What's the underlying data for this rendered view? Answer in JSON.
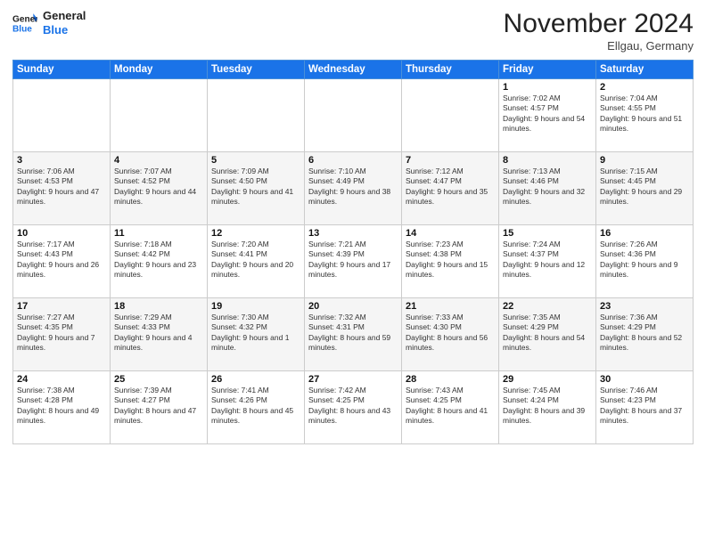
{
  "header": {
    "logo_line1": "General",
    "logo_line2": "Blue",
    "month_title": "November 2024",
    "location": "Ellgau, Germany"
  },
  "columns": [
    "Sunday",
    "Monday",
    "Tuesday",
    "Wednesday",
    "Thursday",
    "Friday",
    "Saturday"
  ],
  "weeks": [
    [
      {
        "day": "",
        "info": ""
      },
      {
        "day": "",
        "info": ""
      },
      {
        "day": "",
        "info": ""
      },
      {
        "day": "",
        "info": ""
      },
      {
        "day": "",
        "info": ""
      },
      {
        "day": "1",
        "info": "Sunrise: 7:02 AM\nSunset: 4:57 PM\nDaylight: 9 hours and 54 minutes."
      },
      {
        "day": "2",
        "info": "Sunrise: 7:04 AM\nSunset: 4:55 PM\nDaylight: 9 hours and 51 minutes."
      }
    ],
    [
      {
        "day": "3",
        "info": "Sunrise: 7:06 AM\nSunset: 4:53 PM\nDaylight: 9 hours and 47 minutes."
      },
      {
        "day": "4",
        "info": "Sunrise: 7:07 AM\nSunset: 4:52 PM\nDaylight: 9 hours and 44 minutes."
      },
      {
        "day": "5",
        "info": "Sunrise: 7:09 AM\nSunset: 4:50 PM\nDaylight: 9 hours and 41 minutes."
      },
      {
        "day": "6",
        "info": "Sunrise: 7:10 AM\nSunset: 4:49 PM\nDaylight: 9 hours and 38 minutes."
      },
      {
        "day": "7",
        "info": "Sunrise: 7:12 AM\nSunset: 4:47 PM\nDaylight: 9 hours and 35 minutes."
      },
      {
        "day": "8",
        "info": "Sunrise: 7:13 AM\nSunset: 4:46 PM\nDaylight: 9 hours and 32 minutes."
      },
      {
        "day": "9",
        "info": "Sunrise: 7:15 AM\nSunset: 4:45 PM\nDaylight: 9 hours and 29 minutes."
      }
    ],
    [
      {
        "day": "10",
        "info": "Sunrise: 7:17 AM\nSunset: 4:43 PM\nDaylight: 9 hours and 26 minutes."
      },
      {
        "day": "11",
        "info": "Sunrise: 7:18 AM\nSunset: 4:42 PM\nDaylight: 9 hours and 23 minutes."
      },
      {
        "day": "12",
        "info": "Sunrise: 7:20 AM\nSunset: 4:41 PM\nDaylight: 9 hours and 20 minutes."
      },
      {
        "day": "13",
        "info": "Sunrise: 7:21 AM\nSunset: 4:39 PM\nDaylight: 9 hours and 17 minutes."
      },
      {
        "day": "14",
        "info": "Sunrise: 7:23 AM\nSunset: 4:38 PM\nDaylight: 9 hours and 15 minutes."
      },
      {
        "day": "15",
        "info": "Sunrise: 7:24 AM\nSunset: 4:37 PM\nDaylight: 9 hours and 12 minutes."
      },
      {
        "day": "16",
        "info": "Sunrise: 7:26 AM\nSunset: 4:36 PM\nDaylight: 9 hours and 9 minutes."
      }
    ],
    [
      {
        "day": "17",
        "info": "Sunrise: 7:27 AM\nSunset: 4:35 PM\nDaylight: 9 hours and 7 minutes."
      },
      {
        "day": "18",
        "info": "Sunrise: 7:29 AM\nSunset: 4:33 PM\nDaylight: 9 hours and 4 minutes."
      },
      {
        "day": "19",
        "info": "Sunrise: 7:30 AM\nSunset: 4:32 PM\nDaylight: 9 hours and 1 minute."
      },
      {
        "day": "20",
        "info": "Sunrise: 7:32 AM\nSunset: 4:31 PM\nDaylight: 8 hours and 59 minutes."
      },
      {
        "day": "21",
        "info": "Sunrise: 7:33 AM\nSunset: 4:30 PM\nDaylight: 8 hours and 56 minutes."
      },
      {
        "day": "22",
        "info": "Sunrise: 7:35 AM\nSunset: 4:29 PM\nDaylight: 8 hours and 54 minutes."
      },
      {
        "day": "23",
        "info": "Sunrise: 7:36 AM\nSunset: 4:29 PM\nDaylight: 8 hours and 52 minutes."
      }
    ],
    [
      {
        "day": "24",
        "info": "Sunrise: 7:38 AM\nSunset: 4:28 PM\nDaylight: 8 hours and 49 minutes."
      },
      {
        "day": "25",
        "info": "Sunrise: 7:39 AM\nSunset: 4:27 PM\nDaylight: 8 hours and 47 minutes."
      },
      {
        "day": "26",
        "info": "Sunrise: 7:41 AM\nSunset: 4:26 PM\nDaylight: 8 hours and 45 minutes."
      },
      {
        "day": "27",
        "info": "Sunrise: 7:42 AM\nSunset: 4:25 PM\nDaylight: 8 hours and 43 minutes."
      },
      {
        "day": "28",
        "info": "Sunrise: 7:43 AM\nSunset: 4:25 PM\nDaylight: 8 hours and 41 minutes."
      },
      {
        "day": "29",
        "info": "Sunrise: 7:45 AM\nSunset: 4:24 PM\nDaylight: 8 hours and 39 minutes."
      },
      {
        "day": "30",
        "info": "Sunrise: 7:46 AM\nSunset: 4:23 PM\nDaylight: 8 hours and 37 minutes."
      }
    ]
  ]
}
